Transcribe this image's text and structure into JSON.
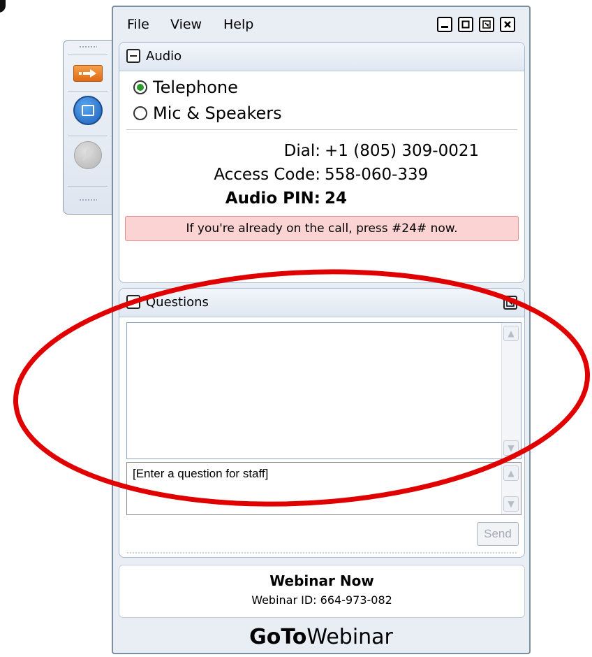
{
  "menu": {
    "file": "File",
    "view": "View",
    "help": "Help"
  },
  "audio": {
    "title": "Audio",
    "options": [
      {
        "label": "Telephone",
        "selected": true
      },
      {
        "label": "Mic & Speakers",
        "selected": false
      }
    ],
    "dial_label": "Dial:",
    "dial_value": "+1 (805) 309-0021",
    "access_label": "Access Code:",
    "access_value": "558-060-339",
    "pin_label": "Audio PIN:",
    "pin_value": "24",
    "notice": "If you're already on the call, press #24# now."
  },
  "questions": {
    "title": "Questions",
    "placeholder": "[Enter a question for staff]",
    "send_label": "Send"
  },
  "webinar": {
    "name": "Webinar Now",
    "id_text": "Webinar ID: 664-973-082"
  },
  "brand": {
    "bold": "GoTo",
    "light": "Webinar"
  },
  "colors": {
    "annotation": "#e00000",
    "accent_orange": "#e06a14",
    "accent_blue": "#1c5fb8",
    "notice_bg": "#fcd3d3",
    "radio_selected": "#2a9a2a"
  },
  "icons": {
    "toolbar": [
      "grip-icon",
      "arrow-right-icon",
      "screen-share-icon",
      "mic-muted-icon",
      "grip-icon"
    ],
    "window": [
      "minimize-icon",
      "maximize-icon",
      "popout-icon",
      "close-icon"
    ]
  }
}
